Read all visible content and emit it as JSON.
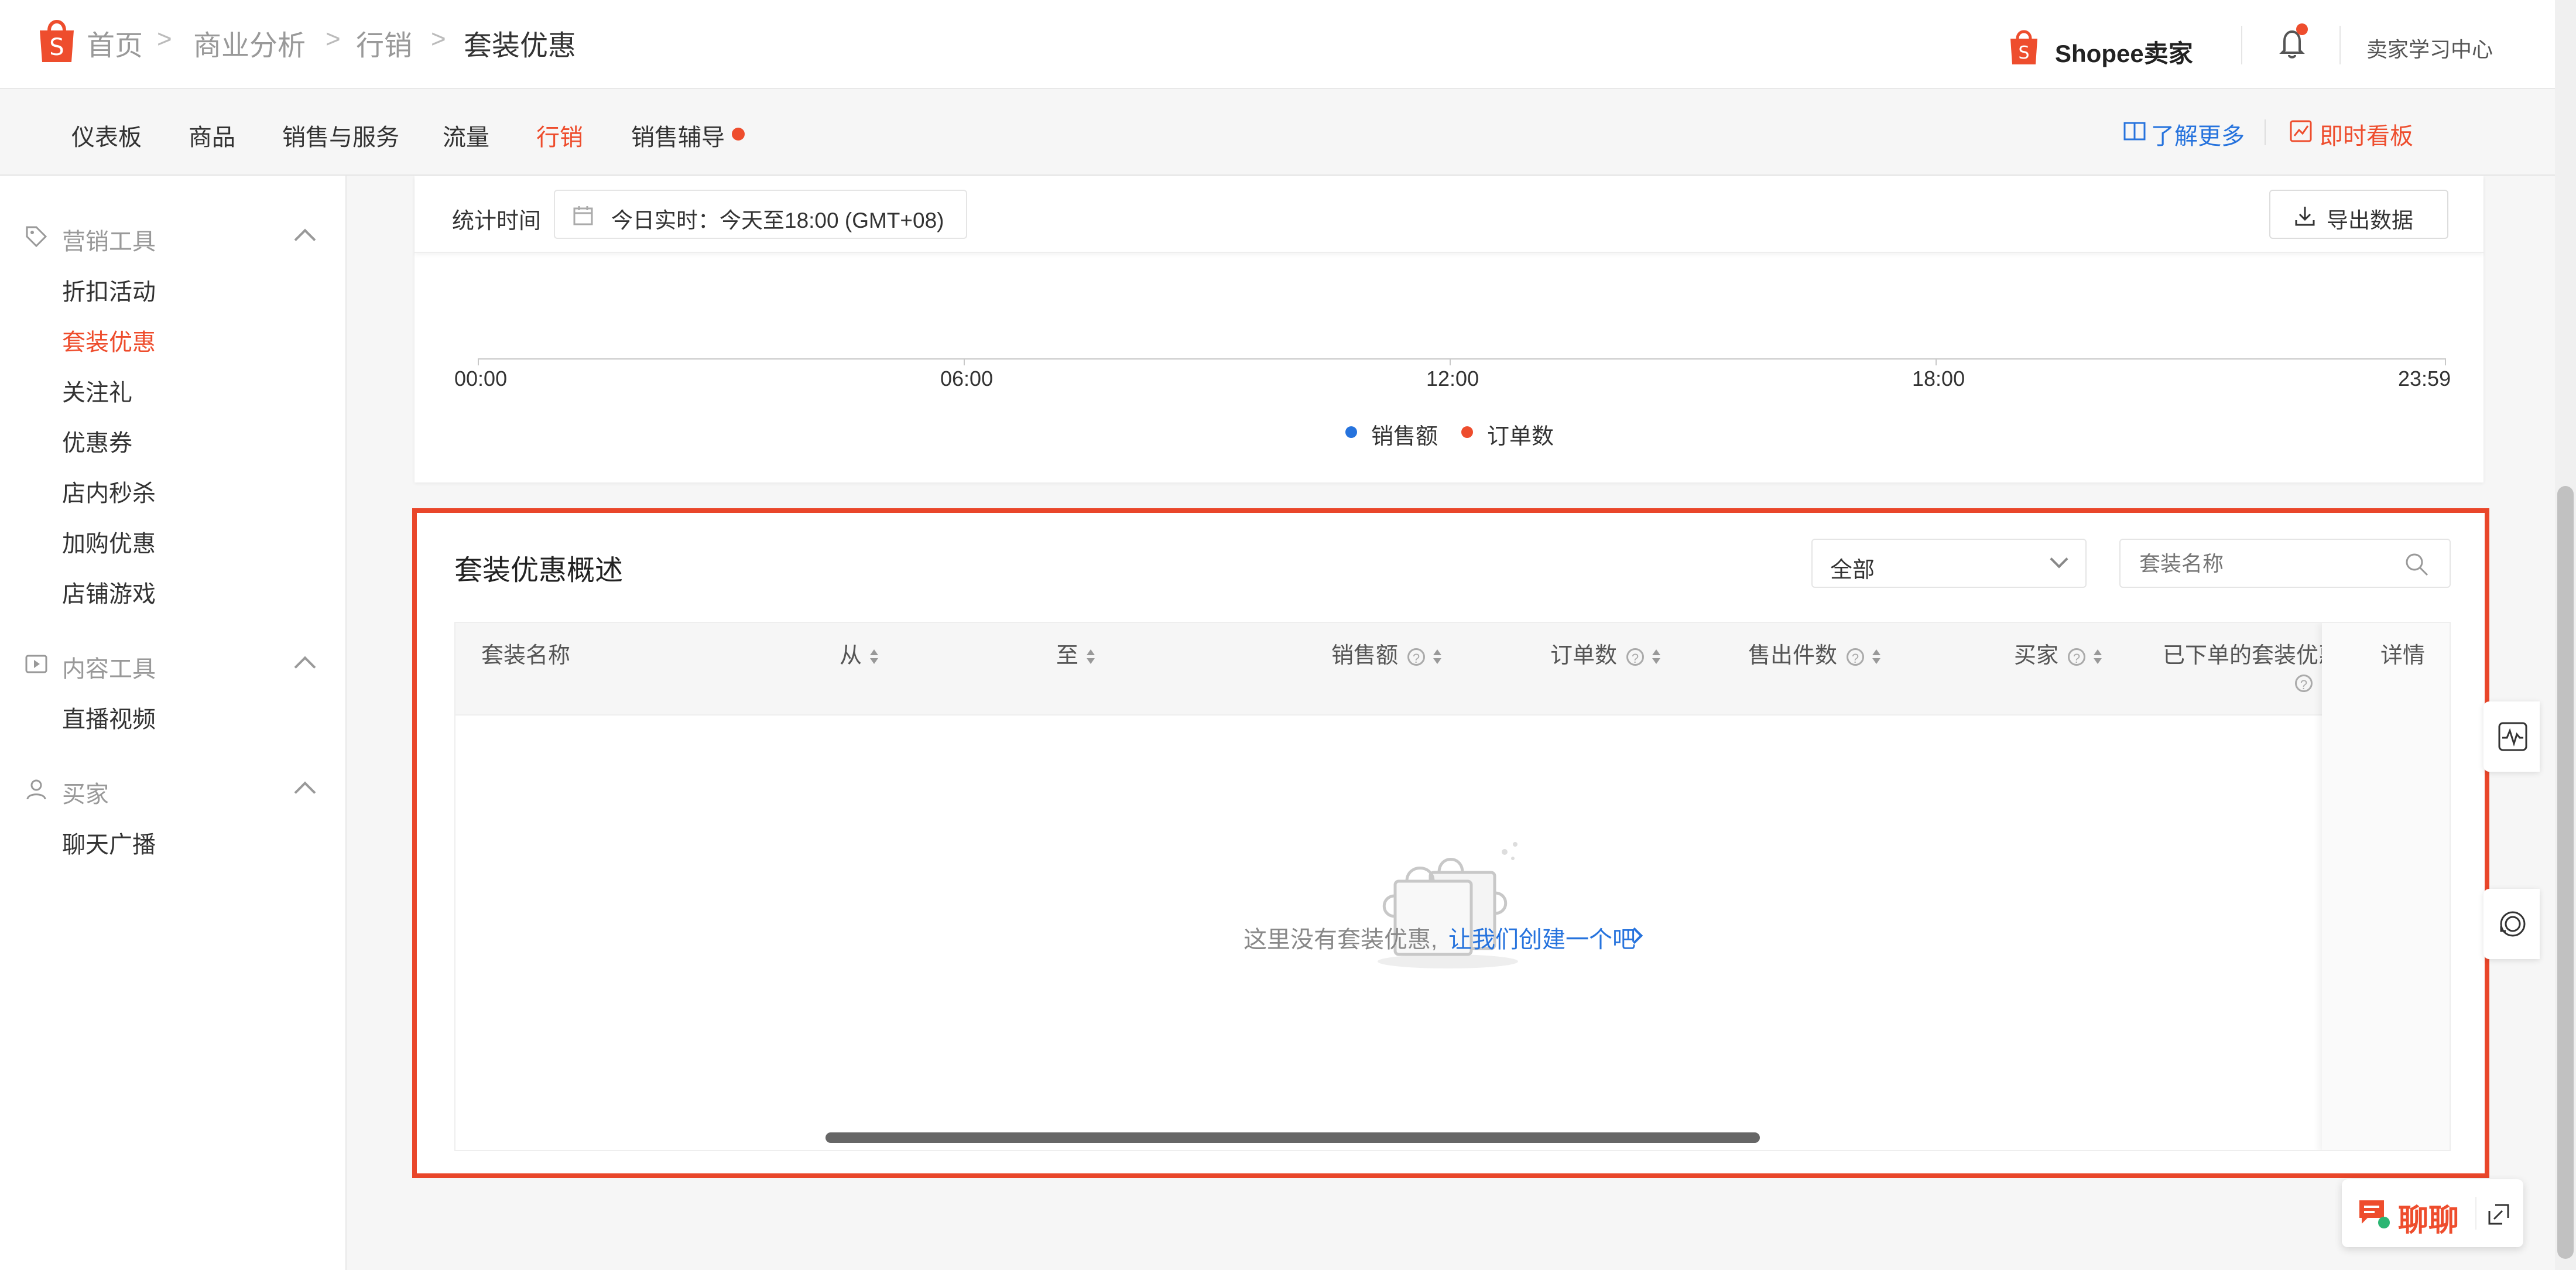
{
  "header": {
    "breadcrumb": [
      "首页",
      "商业分析",
      "行销",
      "套装优惠"
    ],
    "brand_text": "Shopee卖家",
    "learning_center": "卖家学习中心"
  },
  "nav": {
    "items": [
      "仪表板",
      "商品",
      "销售与服务",
      "流量",
      "行销",
      "销售辅导"
    ],
    "active": "行销",
    "learn_more": "了解更多",
    "realtime_board": "即时看板"
  },
  "sidebar": {
    "groups": [
      {
        "label": "营销工具",
        "items": [
          "折扣活动",
          "套装优惠",
          "关注礼",
          "优惠券",
          "店内秒杀",
          "加购优惠",
          "店铺游戏"
        ]
      },
      {
        "label": "内容工具",
        "items": [
          "直播视频"
        ]
      },
      {
        "label": "买家",
        "items": [
          "聊天广播"
        ]
      }
    ],
    "active_item": "套装优惠"
  },
  "stats": {
    "time_label": "统计时间",
    "time_value": "今日实时：今天至18:00 (GMT+08)",
    "export": "导出数据",
    "x_ticks": [
      "00:00",
      "06:00",
      "12:00",
      "18:00",
      "23:59"
    ],
    "legend": [
      {
        "name": "销售额",
        "color": "#2673dd"
      },
      {
        "name": "订单数",
        "color": "#ee4d2d"
      }
    ]
  },
  "overview": {
    "title": "套装优惠概述",
    "filter_value": "全部",
    "search_placeholder": "套装名称",
    "columns": [
      "套装名称",
      "从",
      "至",
      "销售额",
      "订单数",
      "售出件数",
      "买家",
      "已下单的套装优惠",
      "详情"
    ],
    "empty_text": "这里没有套装优惠,",
    "create_link": "让我们创建一个吧"
  },
  "chat": {
    "label": "聊聊"
  },
  "colors": {
    "brand": "#ee4d2d",
    "link": "#2673dd"
  }
}
